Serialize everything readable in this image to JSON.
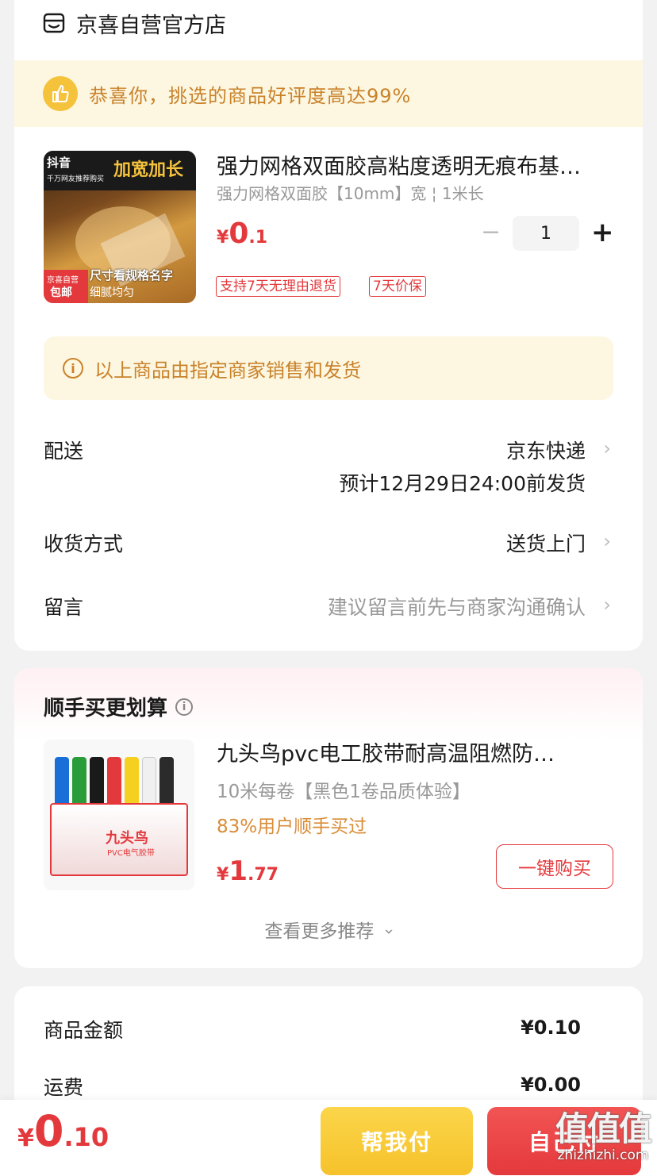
{
  "store": {
    "name": "京喜自营官方店",
    "icon": "store-icon"
  },
  "congrats": {
    "text": "恭喜你，挑选的商品好评度高达99%",
    "icon": "thumbs-up-icon"
  },
  "product": {
    "title": "强力网格双面胶高粘度透明无痕布基…",
    "spec": "强力网格双面胶【10mm】宽 ¦ 1米长",
    "price_symbol": "¥",
    "price_int": "0",
    "price_dec": ".1",
    "quantity": "1",
    "minus_label": "−",
    "plus_label": "+",
    "tags": [
      "支持7天无理由退货",
      "7天价保"
    ],
    "image": {
      "badge_top_left": "抖音",
      "headline": "加宽加长",
      "subline": "千万网友推荐购买",
      "band": "尺寸看规格名字",
      "badge_store": "京喜自营",
      "badge_ship": "包邮",
      "foot": "细腻均匀"
    }
  },
  "notice": {
    "text": "以上商品由指定商家销售和发货",
    "icon": "info-icon"
  },
  "delivery": {
    "label": "配送",
    "carrier": "京东快递",
    "estimate": "预计12月29日24:00前发货",
    "method_label": "收货方式",
    "method_value": "送货上门",
    "message_label": "留言",
    "message_placeholder": "建议留言前先与商家沟通确认"
  },
  "recommend": {
    "title": "顺手买更划算",
    "product_title": "九头鸟pvc电工胶带耐高温阻燃防…",
    "spec": "10米每卷【黑色1卷品质体验】",
    "popularity": "83%用户顺手买过",
    "price_symbol": "¥",
    "price_int": "1",
    "price_dec": ".77",
    "buy_button": "一键购买",
    "see_more": "查看更多推荐",
    "image_brand": "九头鸟",
    "image_sub": "PVC电气胶带"
  },
  "summary": {
    "goods_label": "商品金额",
    "goods_value": "¥0.10",
    "shipping_label": "运费",
    "shipping_value": "¥0.00"
  },
  "bottom": {
    "total_symbol": "¥",
    "total_int": "0",
    "total_dec": ".10",
    "help_pay": "帮我付",
    "self_pay": "自己付"
  },
  "watermark": {
    "big": "值值值",
    "small": "zhizhizhi.com"
  },
  "colors": {
    "accent_red": "#e4393c",
    "gold": "#c9822a",
    "yellow_btn": "#f6c22b"
  }
}
